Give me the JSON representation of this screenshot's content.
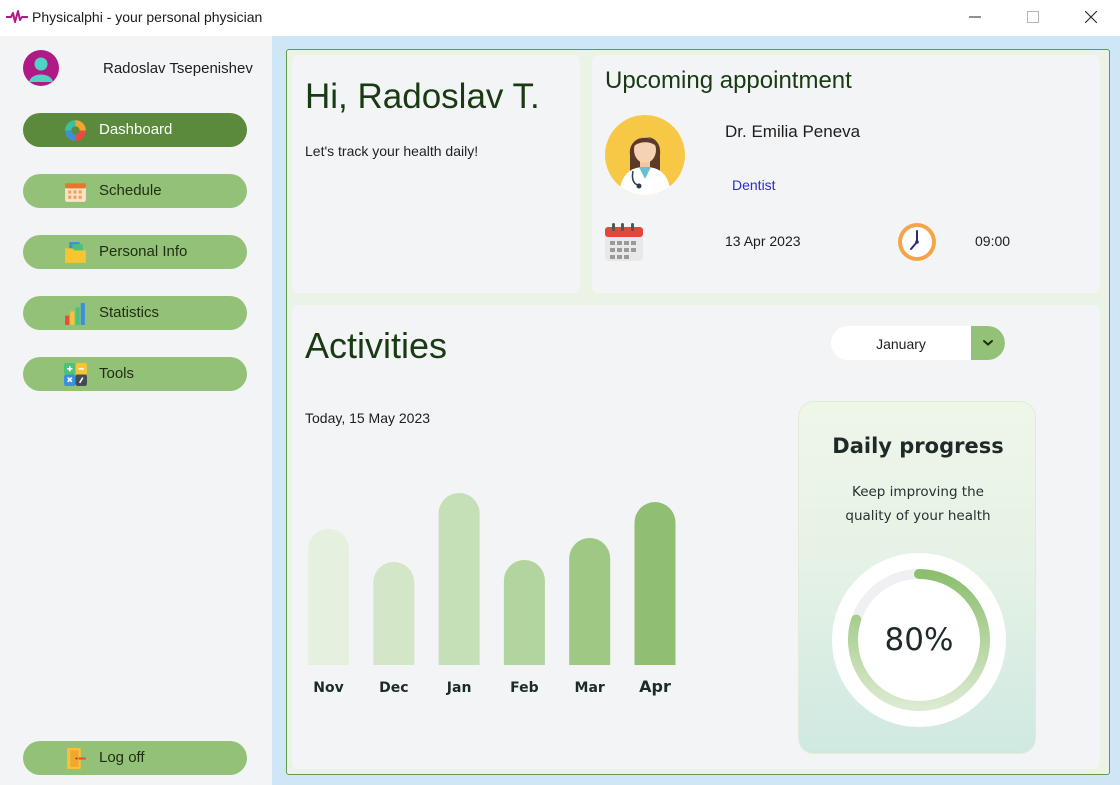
{
  "window": {
    "title": "Physicalphi - your personal physician"
  },
  "sidebar": {
    "user_name": "Radoslav Tsepenishev",
    "items": [
      {
        "label": "Dashboard",
        "icon": "dashboard-icon",
        "active": true
      },
      {
        "label": "Schedule",
        "icon": "calendar-icon",
        "active": false
      },
      {
        "label": "Personal Info",
        "icon": "folder-icon",
        "active": false
      },
      {
        "label": "Statistics",
        "icon": "bar-chart-icon",
        "active": false
      },
      {
        "label": "Tools",
        "icon": "calculator-icon",
        "active": false
      }
    ],
    "logoff_label": "Log off"
  },
  "greeting": {
    "title": "Hi, Radoslav T.",
    "subtitle": "Let's track your health daily!"
  },
  "appointment": {
    "title": "Upcoming appointment",
    "doctor_name": "Dr. Emilia Peneva",
    "specialty": "Dentist",
    "date": "13 Apr 2023",
    "time": "09:00"
  },
  "activities": {
    "title": "Activities",
    "date": "Today, 15 May 2023",
    "month_selected": "January"
  },
  "chart_data": {
    "type": "bar",
    "categories": [
      "Nov",
      "Dec",
      "Jan",
      "Feb",
      "Mar",
      "Apr"
    ],
    "values": [
      136,
      103,
      172,
      105,
      127,
      163
    ],
    "colors": [
      "#e6f0df",
      "#d3e6c8",
      "#c5dfb6",
      "#b2d49e",
      "#9fc884",
      "#90bf73"
    ]
  },
  "progress": {
    "title": "Daily progress",
    "subtitle_line1": "Keep improving the",
    "subtitle_line2": "quality of your health",
    "value_label": "80%",
    "fraction": 0.8,
    "accent": "#8cbf6d"
  },
  "colors": {
    "accent": "#93c177",
    "active": "#5b8a3c",
    "heading": "#193a12",
    "link": "#2b2bd6"
  }
}
